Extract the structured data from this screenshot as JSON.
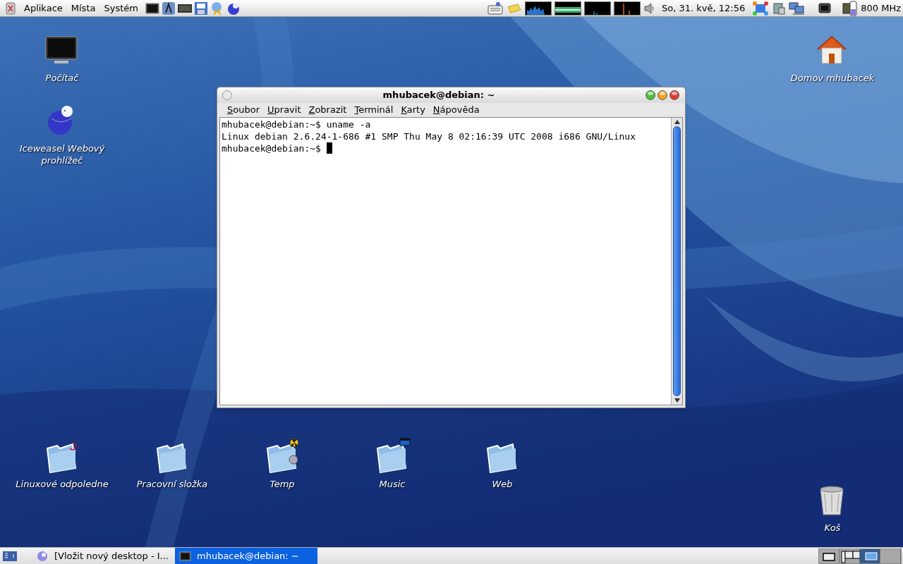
{
  "top_panel": {
    "menus": [
      "Aplikace",
      "Místa",
      "Systém"
    ],
    "clock": "So, 31. kvě, 12:56",
    "cpu_frequency": "800 MHz"
  },
  "desktop_icons": [
    {
      "label": "Počítač",
      "kind": "computer"
    },
    {
      "label": "Iceweasel Webový prohlížeč",
      "kind": "browser"
    },
    {
      "label": "Domov mhubacek",
      "kind": "home"
    },
    {
      "label": "Linuxové odpoledne",
      "kind": "folder"
    },
    {
      "label": "Pracovní složka",
      "kind": "folder"
    },
    {
      "label": "Temp",
      "kind": "folder"
    },
    {
      "label": "Music",
      "kind": "folder"
    },
    {
      "label": "Web",
      "kind": "folder"
    },
    {
      "label": "Koš",
      "kind": "trash"
    }
  ],
  "terminal": {
    "title": "mhubacek@debian: ~",
    "menus": [
      "Soubor",
      "Upravit",
      "Zobrazit",
      "Terminál",
      "Karty",
      "Nápověda"
    ],
    "lines": [
      "mhubacek@debian:~$ uname -a",
      "Linux debian 2.6.24-1-686 #1 SMP Thu May 8 02:16:39 UTC 2008 i686 GNU/Linux",
      "mhubacek@debian:~$ "
    ],
    "cursor": true
  },
  "taskbar": {
    "tasks": [
      {
        "label": "[Vložit nový desktop - I...",
        "selected": false
      },
      {
        "label": "mhubacek@debian: ~",
        "selected": true
      }
    ],
    "workspaces": [
      {
        "selected": false
      },
      {
        "selected": false
      },
      {
        "selected": true
      },
      {
        "selected": false
      }
    ]
  }
}
